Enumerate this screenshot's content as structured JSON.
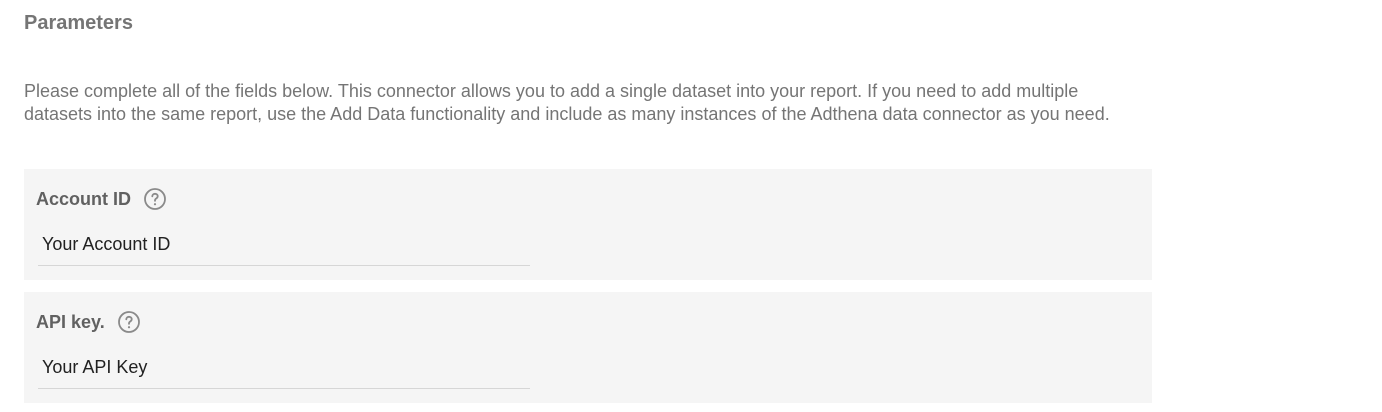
{
  "section": {
    "title": "Parameters",
    "description": "Please complete all of the fields below. This connector allows you to add a single dataset into your report. If you need to add multiple datasets into the same report, use the Add Data functionality and include as many instances of the Adthena data connector as you need."
  },
  "fields": [
    {
      "label": "Account ID",
      "help_icon": "help-circle-icon",
      "placeholder": "Your Account ID",
      "value": ""
    },
    {
      "label": "API key.",
      "help_icon": "help-circle-icon",
      "placeholder": "Your API Key",
      "value": ""
    }
  ],
  "colors": {
    "title": "#757575",
    "description": "#757575",
    "card_background": "#f5f5f5",
    "label": "#616161",
    "input_text": "#212121",
    "underline": "#d6d6d6"
  }
}
